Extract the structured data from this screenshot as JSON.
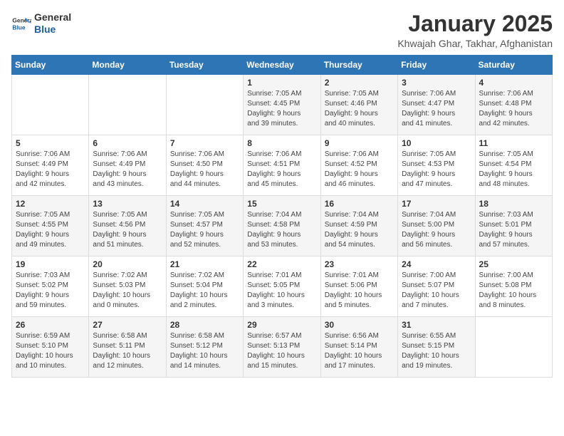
{
  "logo": {
    "line1": "General",
    "line2": "Blue"
  },
  "title": "January 2025",
  "location": "Khwajah Ghar, Takhar, Afghanistan",
  "weekdays": [
    "Sunday",
    "Monday",
    "Tuesday",
    "Wednesday",
    "Thursday",
    "Friday",
    "Saturday"
  ],
  "weeks": [
    [
      {
        "day": "",
        "info": ""
      },
      {
        "day": "",
        "info": ""
      },
      {
        "day": "",
        "info": ""
      },
      {
        "day": "1",
        "info": "Sunrise: 7:05 AM\nSunset: 4:45 PM\nDaylight: 9 hours\nand 39 minutes."
      },
      {
        "day": "2",
        "info": "Sunrise: 7:05 AM\nSunset: 4:46 PM\nDaylight: 9 hours\nand 40 minutes."
      },
      {
        "day": "3",
        "info": "Sunrise: 7:06 AM\nSunset: 4:47 PM\nDaylight: 9 hours\nand 41 minutes."
      },
      {
        "day": "4",
        "info": "Sunrise: 7:06 AM\nSunset: 4:48 PM\nDaylight: 9 hours\nand 42 minutes."
      }
    ],
    [
      {
        "day": "5",
        "info": "Sunrise: 7:06 AM\nSunset: 4:49 PM\nDaylight: 9 hours\nand 42 minutes."
      },
      {
        "day": "6",
        "info": "Sunrise: 7:06 AM\nSunset: 4:49 PM\nDaylight: 9 hours\nand 43 minutes."
      },
      {
        "day": "7",
        "info": "Sunrise: 7:06 AM\nSunset: 4:50 PM\nDaylight: 9 hours\nand 44 minutes."
      },
      {
        "day": "8",
        "info": "Sunrise: 7:06 AM\nSunset: 4:51 PM\nDaylight: 9 hours\nand 45 minutes."
      },
      {
        "day": "9",
        "info": "Sunrise: 7:06 AM\nSunset: 4:52 PM\nDaylight: 9 hours\nand 46 minutes."
      },
      {
        "day": "10",
        "info": "Sunrise: 7:05 AM\nSunset: 4:53 PM\nDaylight: 9 hours\nand 47 minutes."
      },
      {
        "day": "11",
        "info": "Sunrise: 7:05 AM\nSunset: 4:54 PM\nDaylight: 9 hours\nand 48 minutes."
      }
    ],
    [
      {
        "day": "12",
        "info": "Sunrise: 7:05 AM\nSunset: 4:55 PM\nDaylight: 9 hours\nand 49 minutes."
      },
      {
        "day": "13",
        "info": "Sunrise: 7:05 AM\nSunset: 4:56 PM\nDaylight: 9 hours\nand 51 minutes."
      },
      {
        "day": "14",
        "info": "Sunrise: 7:05 AM\nSunset: 4:57 PM\nDaylight: 9 hours\nand 52 minutes."
      },
      {
        "day": "15",
        "info": "Sunrise: 7:04 AM\nSunset: 4:58 PM\nDaylight: 9 hours\nand 53 minutes."
      },
      {
        "day": "16",
        "info": "Sunrise: 7:04 AM\nSunset: 4:59 PM\nDaylight: 9 hours\nand 54 minutes."
      },
      {
        "day": "17",
        "info": "Sunrise: 7:04 AM\nSunset: 5:00 PM\nDaylight: 9 hours\nand 56 minutes."
      },
      {
        "day": "18",
        "info": "Sunrise: 7:03 AM\nSunset: 5:01 PM\nDaylight: 9 hours\nand 57 minutes."
      }
    ],
    [
      {
        "day": "19",
        "info": "Sunrise: 7:03 AM\nSunset: 5:02 PM\nDaylight: 9 hours\nand 59 minutes."
      },
      {
        "day": "20",
        "info": "Sunrise: 7:02 AM\nSunset: 5:03 PM\nDaylight: 10 hours\nand 0 minutes."
      },
      {
        "day": "21",
        "info": "Sunrise: 7:02 AM\nSunset: 5:04 PM\nDaylight: 10 hours\nand 2 minutes."
      },
      {
        "day": "22",
        "info": "Sunrise: 7:01 AM\nSunset: 5:05 PM\nDaylight: 10 hours\nand 3 minutes."
      },
      {
        "day": "23",
        "info": "Sunrise: 7:01 AM\nSunset: 5:06 PM\nDaylight: 10 hours\nand 5 minutes."
      },
      {
        "day": "24",
        "info": "Sunrise: 7:00 AM\nSunset: 5:07 PM\nDaylight: 10 hours\nand 7 minutes."
      },
      {
        "day": "25",
        "info": "Sunrise: 7:00 AM\nSunset: 5:08 PM\nDaylight: 10 hours\nand 8 minutes."
      }
    ],
    [
      {
        "day": "26",
        "info": "Sunrise: 6:59 AM\nSunset: 5:10 PM\nDaylight: 10 hours\nand 10 minutes."
      },
      {
        "day": "27",
        "info": "Sunrise: 6:58 AM\nSunset: 5:11 PM\nDaylight: 10 hours\nand 12 minutes."
      },
      {
        "day": "28",
        "info": "Sunrise: 6:58 AM\nSunset: 5:12 PM\nDaylight: 10 hours\nand 14 minutes."
      },
      {
        "day": "29",
        "info": "Sunrise: 6:57 AM\nSunset: 5:13 PM\nDaylight: 10 hours\nand 15 minutes."
      },
      {
        "day": "30",
        "info": "Sunrise: 6:56 AM\nSunset: 5:14 PM\nDaylight: 10 hours\nand 17 minutes."
      },
      {
        "day": "31",
        "info": "Sunrise: 6:55 AM\nSunset: 5:15 PM\nDaylight: 10 hours\nand 19 minutes."
      },
      {
        "day": "",
        "info": ""
      }
    ]
  ]
}
